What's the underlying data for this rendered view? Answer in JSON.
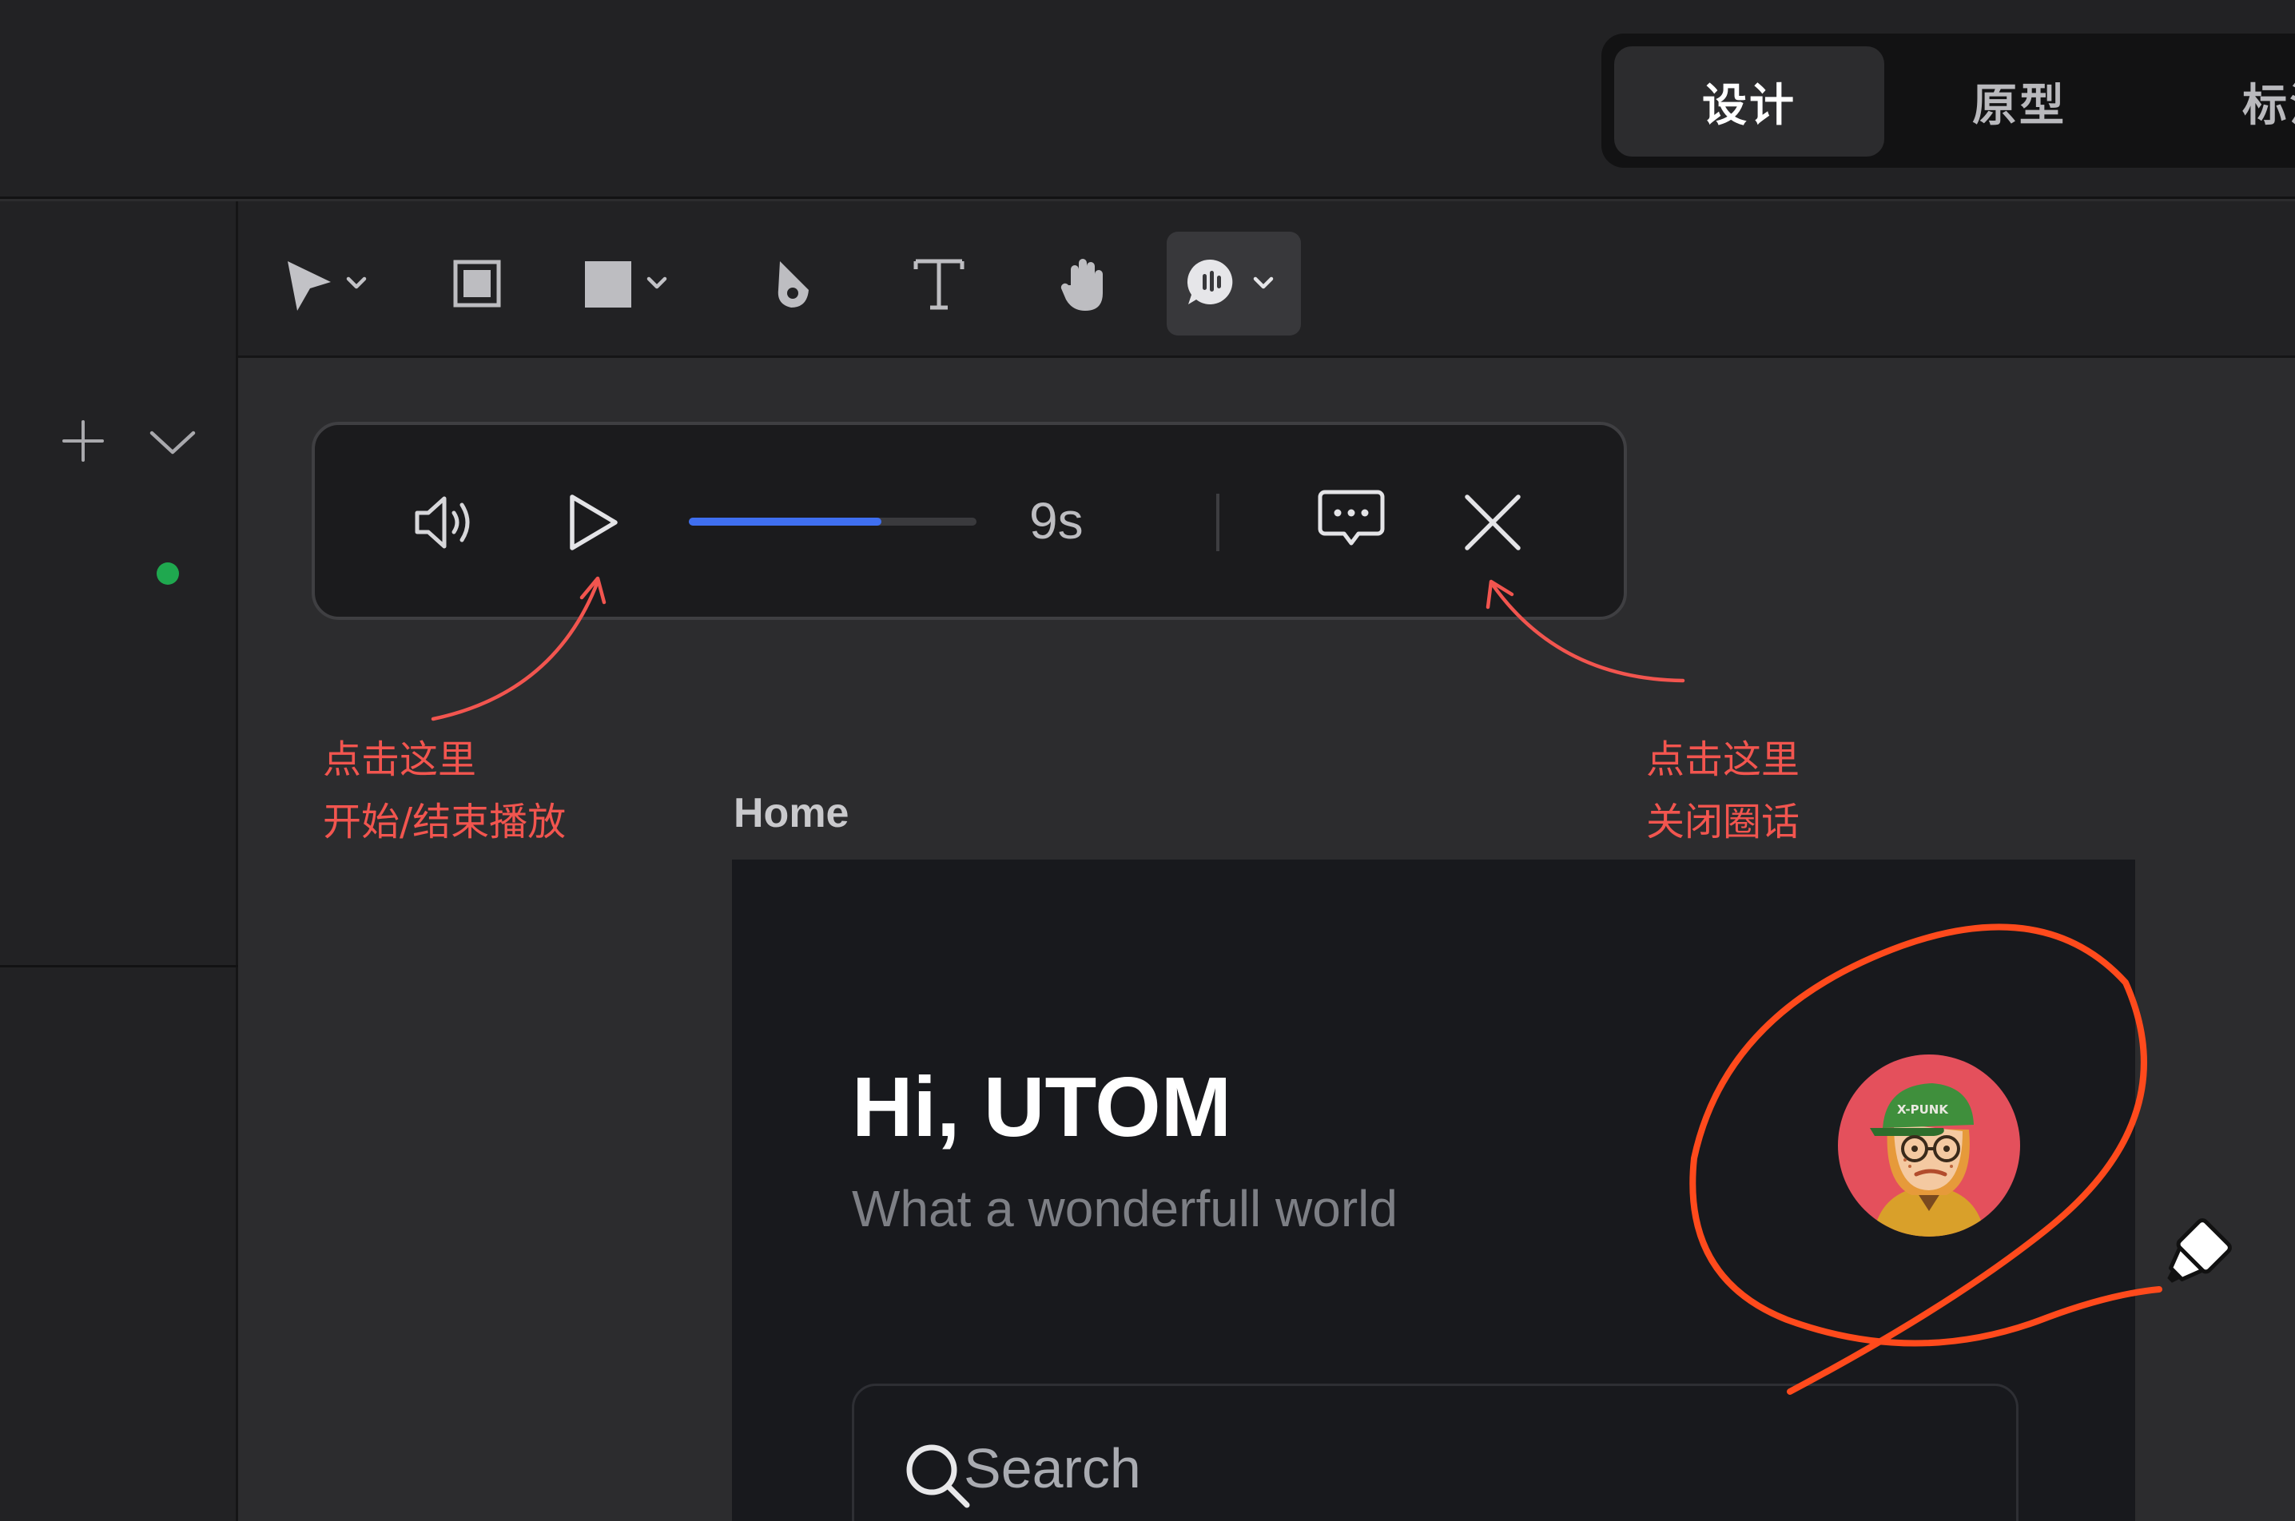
{
  "header": {
    "mode_tabs": [
      {
        "label": "设计",
        "active": true
      },
      {
        "label": "原型",
        "active": false
      },
      {
        "label": "标注",
        "active": false
      }
    ]
  },
  "toolbar": {
    "tools": [
      {
        "name": "move-tool",
        "icon": "cursor-arrow-icon",
        "has_dropdown": true
      },
      {
        "name": "frame-tool",
        "icon": "frame-icon",
        "has_dropdown": false
      },
      {
        "name": "shape-tool",
        "icon": "rectangle-icon",
        "has_dropdown": true
      },
      {
        "name": "pen-tool",
        "icon": "pen-icon",
        "has_dropdown": false
      },
      {
        "name": "text-tool",
        "icon": "text-icon",
        "has_dropdown": false
      },
      {
        "name": "hand-tool",
        "icon": "hand-icon",
        "has_dropdown": false
      },
      {
        "name": "voice-comment-tool",
        "icon": "voice-bubble-icon",
        "has_dropdown": true,
        "selected": true
      }
    ]
  },
  "left_panel": {
    "add_icon": "plus-icon",
    "collapse_icon": "chevron-down-icon",
    "status_dot_color": "#1fa84f"
  },
  "player": {
    "volume_icon": "volume-icon",
    "play_icon": "play-icon",
    "progress": 0.67,
    "duration": "9s",
    "comment_icon": "comment-bubble-icon",
    "close_icon": "close-icon",
    "progress_color": "#3f6ff0"
  },
  "annotations": {
    "left_line1": "点击这里",
    "left_line2": "开始/结束播放",
    "right_line1": "点击这里",
    "right_line2": "关闭圈话",
    "color": "#f2554f"
  },
  "artboard": {
    "label": "Home",
    "greeting": "Hi, UTOM",
    "subtitle": "What a wonderfull world",
    "search_placeholder": "Search",
    "avatar_cap_text": "X-PUNK"
  },
  "doodle": {
    "color": "#ff4a1c",
    "cursor_icon": "marker-pen-icon"
  }
}
